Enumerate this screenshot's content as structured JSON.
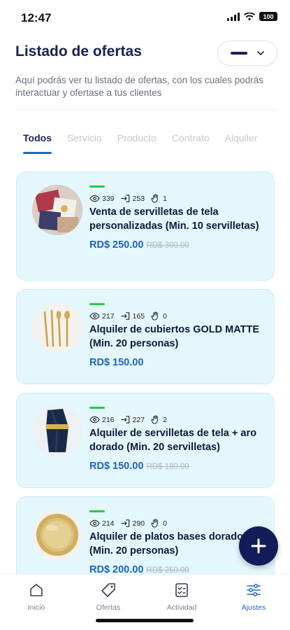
{
  "status_bar": {
    "time": "12:47",
    "battery": "100"
  },
  "header": {
    "title": "Listado de ofertas",
    "subtitle": "Aquí podrás ver tu listado de ofertas, con los cuales podrás interactuar y ofertase a tus clientes"
  },
  "tabs": [
    "Todos",
    "Servicio",
    "Producto",
    "Contrato",
    "Alquiler"
  ],
  "active_tab": "Todos",
  "offers": [
    {
      "views": "339",
      "entries": "253",
      "likes": "1",
      "title": "Venta de servilletas de tela personalizadas (Min. 10 servilletas)",
      "price": "RD$ 250.00",
      "old_price": "RD$ 300.00",
      "image": "napkins-photo"
    },
    {
      "views": "217",
      "entries": "165",
      "likes": "0",
      "title": "Alquiler de cubiertos GOLD MATTE (Min. 20 personas)",
      "price": "RD$ 150.00",
      "old_price": "",
      "image": "gold-cutlery-photo"
    },
    {
      "views": "216",
      "entries": "227",
      "likes": "2",
      "title": "Alquiler de servilletas de tela + aro dorado (Min. 20 servilletas)",
      "price": "RD$ 150.00",
      "old_price": "RD$ 180.00",
      "image": "napkin-ring-photo"
    },
    {
      "views": "214",
      "entries": "290",
      "likes": "0",
      "title": "Alquiler de platos bases dorados (Min. 20 personas)",
      "price": "RD$ 200.00",
      "old_price": "RD$ 250.00",
      "image": "gold-charger-plate-photo"
    }
  ],
  "bottom_nav": [
    {
      "label": "Inicio",
      "icon": "home-icon"
    },
    {
      "label": "Ofertas",
      "icon": "tag-icon"
    },
    {
      "label": "Actividad",
      "icon": "activity-icon"
    },
    {
      "label": "Ajustes",
      "icon": "sliders-icon"
    }
  ],
  "active_nav": "Ajustes",
  "colors": {
    "primary_navy": "#131c58",
    "accent_blue": "#1d66c4",
    "card_background": "#e4f7fc",
    "status_green": "#22cc44"
  }
}
